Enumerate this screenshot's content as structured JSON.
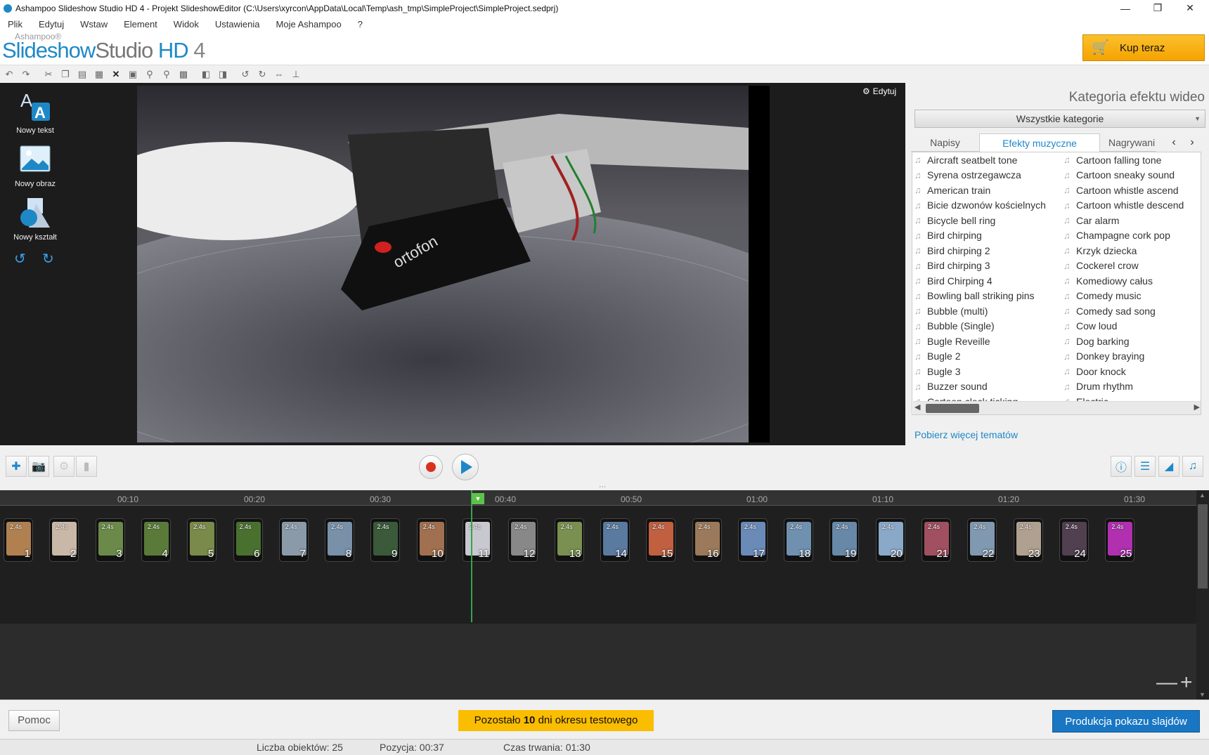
{
  "window": {
    "title": "Ashampoo Slideshow Studio HD 4 - Projekt SlideshowEditor (C:\\Users\\xyrcon\\AppData\\Local\\Temp\\ash_tmp\\SimpleProject\\SimpleProject.sedprj)"
  },
  "menu": [
    "Plik",
    "Edytuj",
    "Wstaw",
    "Element",
    "Widok",
    "Ustawienia",
    "Moje Ashampoo",
    "?"
  ],
  "brand": {
    "small": "Ashampoo®",
    "logo_a": "Slideshow",
    "logo_b": "Studio",
    "logo_c": " HD",
    "logo_d": " 4"
  },
  "buy_button": "Kup teraz",
  "tools": [
    {
      "label": "Nowy tekst",
      "icon": "text-icon"
    },
    {
      "label": "Nowy obraz",
      "icon": "image-icon"
    },
    {
      "label": "Nowy kształt",
      "icon": "shape-icon"
    }
  ],
  "preview": {
    "edit_label": "Edytuj"
  },
  "effects": {
    "category_title": "Kategoria efektu wideo",
    "category_value": "Wszystkie kategorie",
    "tabs": [
      "Napisy",
      "Efekty muzyczne",
      "Nagrywani"
    ],
    "active_tab": "Efekty muzyczne",
    "col1": [
      "Aircraft seatbelt tone",
      "Syrena ostrzegawcza",
      "American train",
      "Bicie dzwonów kościelnych",
      "Bicycle bell ring",
      "Bird chirping",
      "Bird chirping 2",
      "Bird chirping 3",
      "Bird Chirping 4",
      "Bowling ball striking pins",
      "Bubble (multi)",
      "Bubble (Single)",
      "Bugle Reveille",
      "Bugle 2",
      "Bugle 3",
      "Buzzer sound",
      "Cartoon clock ticking"
    ],
    "col2": [
      "Cartoon falling tone",
      "Cartoon sneaky sound",
      "Cartoon whistle ascend",
      "Cartoon whistle descend",
      "Car alarm",
      "Champagne cork pop",
      "Krzyk dziecka",
      "Cockerel crow",
      "Komediowy całus",
      "Comedy music",
      "Comedy sad song",
      "Cow loud",
      "Dog barking",
      "Donkey braying",
      "Door knock",
      "Drum rhythm",
      "Electric"
    ],
    "more_link": "Pobierz więcej tematów"
  },
  "timeline": {
    "ruler": [
      "00:10",
      "00:20",
      "00:30",
      "00:40",
      "00:50",
      "01:00",
      "01:10",
      "01:20",
      "01:30"
    ],
    "slide_duration": "2.4s",
    "slides": [
      {
        "num": "1",
        "color": "#b08050"
      },
      {
        "num": "2",
        "color": "#c9b8a8"
      },
      {
        "num": "3",
        "color": "#6b8a4a"
      },
      {
        "num": "4",
        "color": "#5a7a3a"
      },
      {
        "num": "5",
        "color": "#7a8a4a"
      },
      {
        "num": "6",
        "color": "#4a7030"
      },
      {
        "num": "7",
        "color": "#8a9aa8"
      },
      {
        "num": "8",
        "color": "#7890a8"
      },
      {
        "num": "9",
        "color": "#3a5a3a"
      },
      {
        "num": "10",
        "color": "#a07050"
      },
      {
        "num": "11",
        "color": "#c8c8d0"
      },
      {
        "num": "12",
        "color": "#888888"
      },
      {
        "num": "13",
        "color": "#7a9050"
      },
      {
        "num": "14",
        "color": "#5a7aa0"
      },
      {
        "num": "15",
        "color": "#c06040"
      },
      {
        "num": "16",
        "color": "#9a7a5a"
      },
      {
        "num": "17",
        "color": "#6a8ab8"
      },
      {
        "num": "18",
        "color": "#7090b0"
      },
      {
        "num": "19",
        "color": "#6888a8"
      },
      {
        "num": "20",
        "color": "#8aa8c8"
      },
      {
        "num": "21",
        "color": "#a05060"
      },
      {
        "num": "22",
        "color": "#8098b0"
      },
      {
        "num": "23",
        "color": "#b0a090"
      },
      {
        "num": "24",
        "color": "#504050"
      },
      {
        "num": "25",
        "color": "#b030b0"
      }
    ]
  },
  "bottom": {
    "help": "Pomoc",
    "trial_pre": "Pozostało ",
    "trial_days": "10",
    "trial_post": " dni okresu testowego",
    "produce": "Produkcja pokazu slajdów"
  },
  "status": {
    "count": "Liczba obiektów: 25",
    "position": "Pozycja: 00:37",
    "duration": "Czas trwania: 01:30"
  }
}
